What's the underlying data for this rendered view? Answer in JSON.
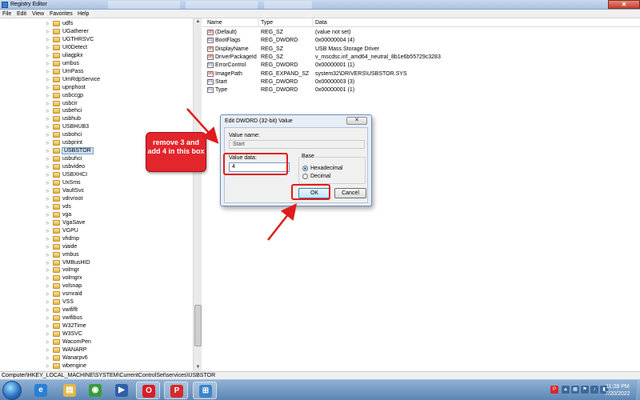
{
  "window": {
    "title": "Registry Editor",
    "close_glyph": "✕"
  },
  "menu": [
    "File",
    "Edit",
    "View",
    "Favorites",
    "Help"
  ],
  "tree": {
    "expander_glyph": "▷",
    "items": [
      "udfs",
      "UGatherer",
      "UGTHRSVC",
      "UI0Detect",
      "uliagpkx",
      "umbus",
      "UmPass",
      "UmRdpService",
      "upnphost",
      "usbccgp",
      "usbcir",
      "usbehci",
      "usbhub",
      "USBHUB3",
      "usbohci",
      "usbprint",
      "USBSTOR",
      "usbuhci",
      "usbvideo",
      "USBXHCI",
      "UxSms",
      "VaultSvc",
      "vdrvroot",
      "vds",
      "vga",
      "VgaSave",
      "VGPU",
      "vhdmp",
      "viaide",
      "vmbus",
      "VMBusHID",
      "volmgr",
      "volmgrx",
      "volsnap",
      "vsmraid",
      "VSS",
      "vwififlt",
      "vwifibus",
      "W32Time",
      "W3SVC",
      "WacomPen",
      "WANARP",
      "Wanarpv6",
      "wbengine"
    ],
    "selected": "USBSTOR"
  },
  "values_panel": {
    "columns": [
      "Name",
      "Type",
      "Data"
    ],
    "rows": [
      {
        "icon": "string-value-icon",
        "badge": "ab",
        "name": "(Default)",
        "type": "REG_SZ",
        "data": "(value not set)"
      },
      {
        "icon": "dword-value-icon",
        "badge": "01",
        "name": "BootFlags",
        "type": "REG_DWORD",
        "data": "0x00000004 (4)"
      },
      {
        "icon": "string-value-icon",
        "badge": "ab",
        "name": "DisplayName",
        "type": "REG_SZ",
        "data": "USB Mass Storage Driver"
      },
      {
        "icon": "string-value-icon",
        "badge": "ab",
        "name": "DriverPackageId",
        "type": "REG_SZ",
        "data": "v_mscdsc.inf_amd64_neutral_8b1e6b55729c3283"
      },
      {
        "icon": "dword-value-icon",
        "badge": "01",
        "name": "ErrorControl",
        "type": "REG_DWORD",
        "data": "0x00000001 (1)"
      },
      {
        "icon": "string-value-icon",
        "badge": "ab",
        "name": "ImagePath",
        "type": "REG_EXPAND_SZ",
        "data": "system32\\DRIVERS\\USBSTOR.SYS"
      },
      {
        "icon": "dword-value-icon",
        "badge": "01",
        "name": "Start",
        "type": "REG_DWORD",
        "data": "0x00000003 (3)"
      },
      {
        "icon": "dword-value-icon",
        "badge": "01",
        "name": "Type",
        "type": "REG_DWORD",
        "data": "0x00000001 (1)"
      }
    ]
  },
  "dialog": {
    "title": "Edit DWORD (32-bit) Value",
    "close_glyph": "✕",
    "value_name_label": "Value name:",
    "value_name": "Start",
    "value_data_label": "Value data:",
    "value_data": "4",
    "base_label": "Base",
    "base_options": [
      "Hexadecimal",
      "Decimal"
    ],
    "base_selected": "Hexadecimal",
    "ok_label": "OK",
    "cancel_label": "Cancel"
  },
  "annotation": {
    "callout_text": "remove 3 and add 4 in this box",
    "color": "#e3252c"
  },
  "status_bar": {
    "path": "Computer\\HKEY_LOCAL_MACHINE\\SYSTEM\\CurrentControlSet\\services\\USBSTOR"
  },
  "taskbar": {
    "buttons": [
      {
        "name": "internet-explorer-icon",
        "glyph": "e",
        "color": "#2a7fd4"
      },
      {
        "name": "file-explorer-icon",
        "glyph": "▤",
        "color": "#e0b84a"
      },
      {
        "name": "chrome-icon",
        "glyph": "◉",
        "color": "#3a9a3a"
      },
      {
        "name": "media-player-icon",
        "glyph": "▶",
        "color": "#2f5fa8"
      },
      {
        "name": "opera-icon",
        "glyph": "O",
        "color": "#d81c24"
      },
      {
        "name": "screenpresso-icon",
        "glyph": "P",
        "color": "#d62a2a"
      },
      {
        "name": "registry-editor-icon",
        "glyph": "⊞",
        "color": "#3b84c9"
      }
    ],
    "tray": [
      {
        "name": "screenpresso-tray-icon",
        "glyph": "P",
        "color": "#d62a2a"
      },
      {
        "name": "show-hidden-icons-icon",
        "glyph": "▲",
        "color": "#3d6a9c"
      },
      {
        "name": "network-icon",
        "glyph": "▦",
        "color": "#3d6a9c"
      },
      {
        "name": "flag-icon",
        "glyph": "⚑",
        "color": "#3d6a9c"
      },
      {
        "name": "volume-icon",
        "glyph": "♪",
        "color": "#3d6a9c"
      },
      {
        "name": "power-icon",
        "glyph": "▮",
        "color": "#3d6a9c"
      }
    ],
    "time": "11:28 PM",
    "date": "7/20/2022"
  }
}
